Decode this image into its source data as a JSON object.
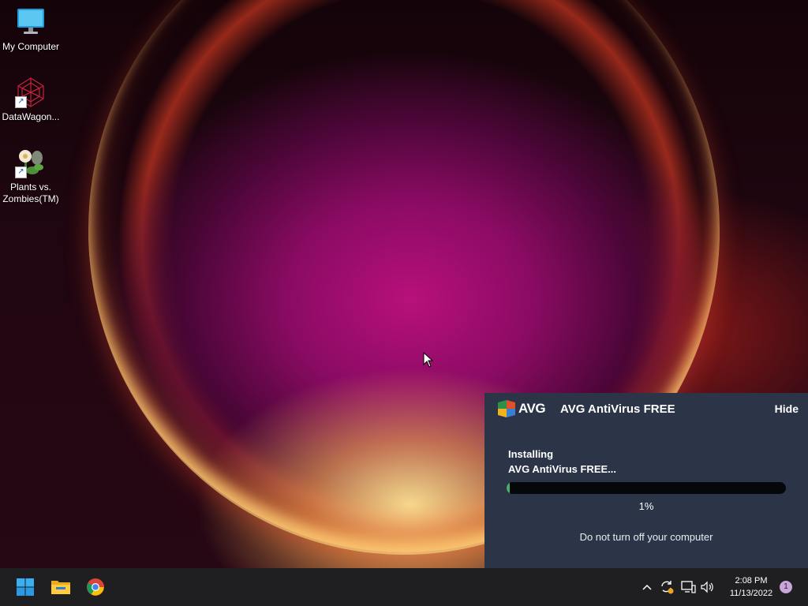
{
  "desktop": {
    "icons": [
      {
        "label": "My Computer",
        "icon": "monitor-icon"
      },
      {
        "label": "DataWagon...",
        "icon": "datawagon-icon"
      },
      {
        "label": "Plants vs. Zombies(TM)",
        "icon": "plants-vs-zombies-icon"
      }
    ]
  },
  "avg": {
    "logo_text": "AVG",
    "title": "AVG AntiVirus FREE",
    "hide_label": "Hide",
    "status_line1": "Installing",
    "status_line2": "AVG AntiVirus FREE...",
    "progress_fraction": 0.01,
    "percent_label": "1%",
    "note": "Do not turn off your computer",
    "colors": {
      "panel_bg": "#2b3547",
      "progress_fill": "#4cae6a",
      "progress_track": "#050709"
    }
  },
  "taskbar": {
    "apps": [
      {
        "name": "Start",
        "icon": "windows-start-icon"
      },
      {
        "name": "File Explorer",
        "icon": "folder-icon"
      },
      {
        "name": "Google Chrome",
        "icon": "chrome-icon"
      }
    ],
    "tray": [
      "chevron-up-icon",
      "sync-update-icon",
      "network-icon",
      "volume-icon"
    ],
    "time": "2:08 PM",
    "date": "11/13/2022",
    "notification_count": "1"
  }
}
